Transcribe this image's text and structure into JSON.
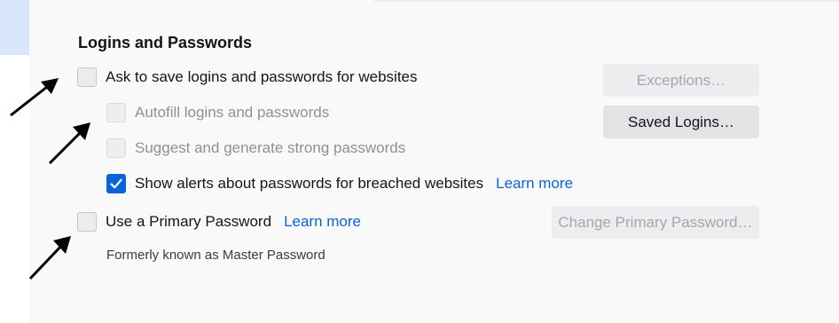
{
  "section": {
    "title": "Logins and Passwords"
  },
  "options": {
    "ask_save": {
      "label": "Ask to save logins and passwords for websites",
      "checked": false
    },
    "autofill": {
      "label": "Autofill logins and passwords",
      "checked": false,
      "enabled": false
    },
    "suggest": {
      "label": "Suggest and generate strong passwords",
      "checked": false,
      "enabled": false
    },
    "breach_alerts": {
      "label": "Show alerts about passwords for breached websites",
      "checked": true,
      "link": "Learn more"
    },
    "primary_password": {
      "label": "Use a Primary Password",
      "checked": false,
      "link": "Learn more",
      "note": "Formerly known as Master Password"
    }
  },
  "buttons": {
    "exceptions": "Exceptions…",
    "saved_logins": "Saved Logins…",
    "change_primary": "Change Primary Password…"
  },
  "colors": {
    "accent": "#0a64d8",
    "topstrip": "#d8e6fa"
  },
  "annotations": {
    "arrow_count": 3
  }
}
